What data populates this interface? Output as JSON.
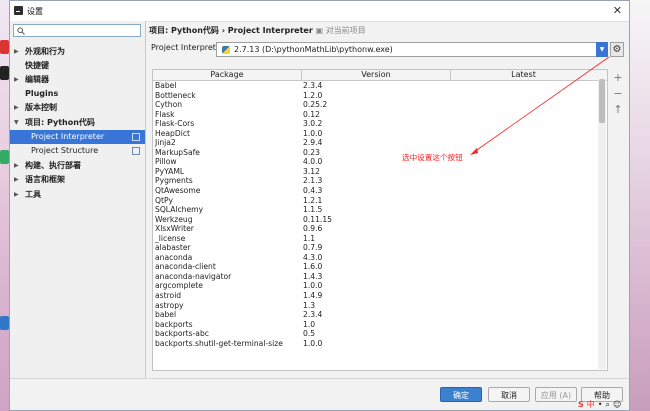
{
  "window": {
    "title": "设置",
    "close_glyph": "✕"
  },
  "search": {
    "placeholder": "",
    "value": ""
  },
  "sidebar": {
    "items": [
      {
        "label": "外观和行为",
        "arrow": "▶",
        "level": 0
      },
      {
        "label": "快捷键",
        "arrow": "",
        "level": 0
      },
      {
        "label": "编辑器",
        "arrow": "▶",
        "level": 0
      },
      {
        "label": "Plugins",
        "arrow": "",
        "level": 0
      },
      {
        "label": "版本控制",
        "arrow": "▶",
        "level": 0
      },
      {
        "label": "项目: Python代码",
        "arrow": "▼",
        "level": 0
      },
      {
        "label": "Project Interpreter",
        "arrow": "",
        "level": 1,
        "selected": true
      },
      {
        "label": "Project Structure",
        "arrow": "",
        "level": 1
      },
      {
        "label": "构建、执行部署",
        "arrow": "▶",
        "level": 0
      },
      {
        "label": "语言和框架",
        "arrow": "▶",
        "level": 0
      },
      {
        "label": "工具",
        "arrow": "▶",
        "level": 0
      }
    ]
  },
  "breadcrumb": {
    "path": "项目: Python代码 › Project Interpreter",
    "scope": "对当前项目"
  },
  "interpreter": {
    "label": "Project Interpreter:",
    "value": "2.7.13 (D:\\pythonMathLib\\pythonw.exe)"
  },
  "table": {
    "headers": [
      "Package",
      "Version",
      "Latest"
    ],
    "rows": [
      [
        "Babel",
        "2.3.4"
      ],
      [
        "Bottleneck",
        "1.2.0"
      ],
      [
        "Cython",
        "0.25.2"
      ],
      [
        "Flask",
        "0.12"
      ],
      [
        "Flask-Cors",
        "3.0.2"
      ],
      [
        "HeapDict",
        "1.0.0"
      ],
      [
        "Jinja2",
        "2.9.4"
      ],
      [
        "MarkupSafe",
        "0.23"
      ],
      [
        "Pillow",
        "4.0.0"
      ],
      [
        "PyYAML",
        "3.12"
      ],
      [
        "Pygments",
        "2.1.3"
      ],
      [
        "QtAwesome",
        "0.4.3"
      ],
      [
        "QtPy",
        "1.2.1"
      ],
      [
        "SQLAlchemy",
        "1.1.5"
      ],
      [
        "Werkzeug",
        "0.11.15"
      ],
      [
        "XlsxWriter",
        "0.9.6"
      ],
      [
        "_license",
        "1.1"
      ],
      [
        "alabaster",
        "0.7.9"
      ],
      [
        "anaconda",
        "4.3.0"
      ],
      [
        "anaconda-client",
        "1.6.0"
      ],
      [
        "anaconda-navigator",
        "1.4.3"
      ],
      [
        "argcomplete",
        "1.0.0"
      ],
      [
        "astroid",
        "1.4.9"
      ],
      [
        "astropy",
        "1.3"
      ],
      [
        "babel",
        "2.3.4"
      ],
      [
        "backports",
        "1.0"
      ],
      [
        "backports-abc",
        "0.5"
      ],
      [
        "backports.shutil-get-terminal-size",
        "1.0.0"
      ]
    ]
  },
  "side_tools": [
    "+",
    "−",
    "↑"
  ],
  "annotation": "选中设置这个按钮",
  "buttons": {
    "ok": "确定",
    "cancel": "取消",
    "apply": "应用 (A)",
    "help": "帮助"
  },
  "tray": {
    "ime": "中",
    "items": [
      "S",
      "•",
      "⌕",
      "☺"
    ]
  },
  "colors": {
    "accent": "#3875d7",
    "annotation": "#ff2020",
    "ok_button": "#3c80d0"
  }
}
